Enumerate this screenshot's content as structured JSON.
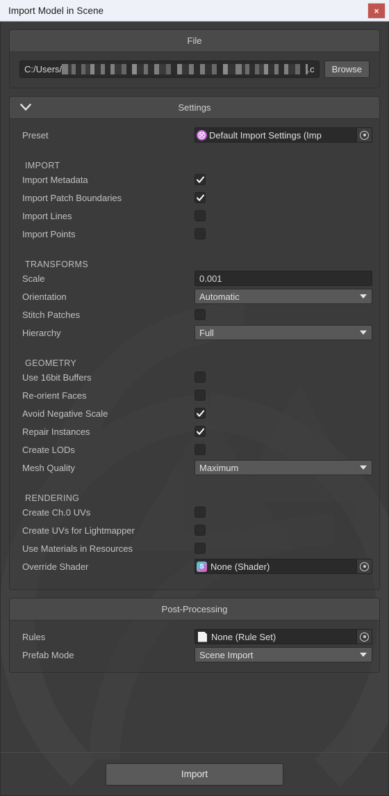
{
  "window": {
    "title": "Import Model in Scene",
    "close_label": "×",
    "close_icon": "close-icon"
  },
  "file_group": {
    "header": "File",
    "path_prefix": "C:/Users/",
    "path_suffix": ".c",
    "path_redacted": true,
    "browse_label": "Browse"
  },
  "settings_group": {
    "header": "Settings",
    "foldout_icon": "chevron-down-icon",
    "expanded": true,
    "preset": {
      "label": "Preset",
      "value": "Default Import Settings (Imp",
      "icon": "preset-icon",
      "picker_icon": "object-picker-icon"
    },
    "sections": [
      {
        "title": "IMPORT",
        "rows": [
          {
            "label": "Import Metadata",
            "type": "checkbox",
            "checked": true
          },
          {
            "label": "Import Patch Boundaries",
            "type": "checkbox",
            "checked": true
          },
          {
            "label": "Import Lines",
            "type": "checkbox",
            "checked": false
          },
          {
            "label": "Import Points",
            "type": "checkbox",
            "checked": false
          }
        ]
      },
      {
        "title": "TRANSFORMS",
        "rows": [
          {
            "label": "Scale",
            "type": "text",
            "value": "0.001"
          },
          {
            "label": "Orientation",
            "type": "dropdown",
            "value": "Automatic"
          },
          {
            "label": "Stitch Patches",
            "type": "checkbox",
            "checked": false
          },
          {
            "label": "Hierarchy",
            "type": "dropdown",
            "value": "Full"
          }
        ]
      },
      {
        "title": "GEOMETRY",
        "rows": [
          {
            "label": "Use 16bit Buffers",
            "type": "checkbox",
            "checked": false
          },
          {
            "label": "Re-orient Faces",
            "type": "checkbox",
            "checked": false
          },
          {
            "label": "Avoid Negative Scale",
            "type": "checkbox",
            "checked": true
          },
          {
            "label": "Repair Instances",
            "type": "checkbox",
            "checked": true
          },
          {
            "label": "Create LODs",
            "type": "checkbox",
            "checked": false
          },
          {
            "label": "Mesh Quality",
            "type": "dropdown",
            "value": "Maximum"
          }
        ]
      },
      {
        "title": "RENDERING",
        "rows": [
          {
            "label": "Create Ch.0 UVs",
            "type": "checkbox",
            "checked": false
          },
          {
            "label": "Create UVs for Lightmapper",
            "type": "checkbox",
            "checked": false
          },
          {
            "label": "Use Materials in Resources",
            "type": "checkbox",
            "checked": false
          },
          {
            "label": "Override Shader",
            "type": "object",
            "value": "None (Shader)",
            "icon": "shader-icon"
          }
        ]
      }
    ]
  },
  "postprocessing_group": {
    "header": "Post-Processing",
    "rows": [
      {
        "label": "Rules",
        "type": "object",
        "value": "None (Rule Set)",
        "icon": "ruleset-icon"
      },
      {
        "label": "Prefab Mode",
        "type": "dropdown",
        "value": "Scene Import"
      }
    ]
  },
  "footer": {
    "import_label": "Import"
  },
  "colors": {
    "titlebar_bg": "#eef1f7",
    "titlebar_text": "#1c1c1c",
    "close_red": "#c25450",
    "panel_bg": "#3c3c3c",
    "group_header_bg": "#4a4a4a",
    "input_bg": "#2a2a2a",
    "dropdown_bg": "#585858",
    "label_text": "#c2c2c2",
    "button_bg": "#5a5a5a"
  }
}
